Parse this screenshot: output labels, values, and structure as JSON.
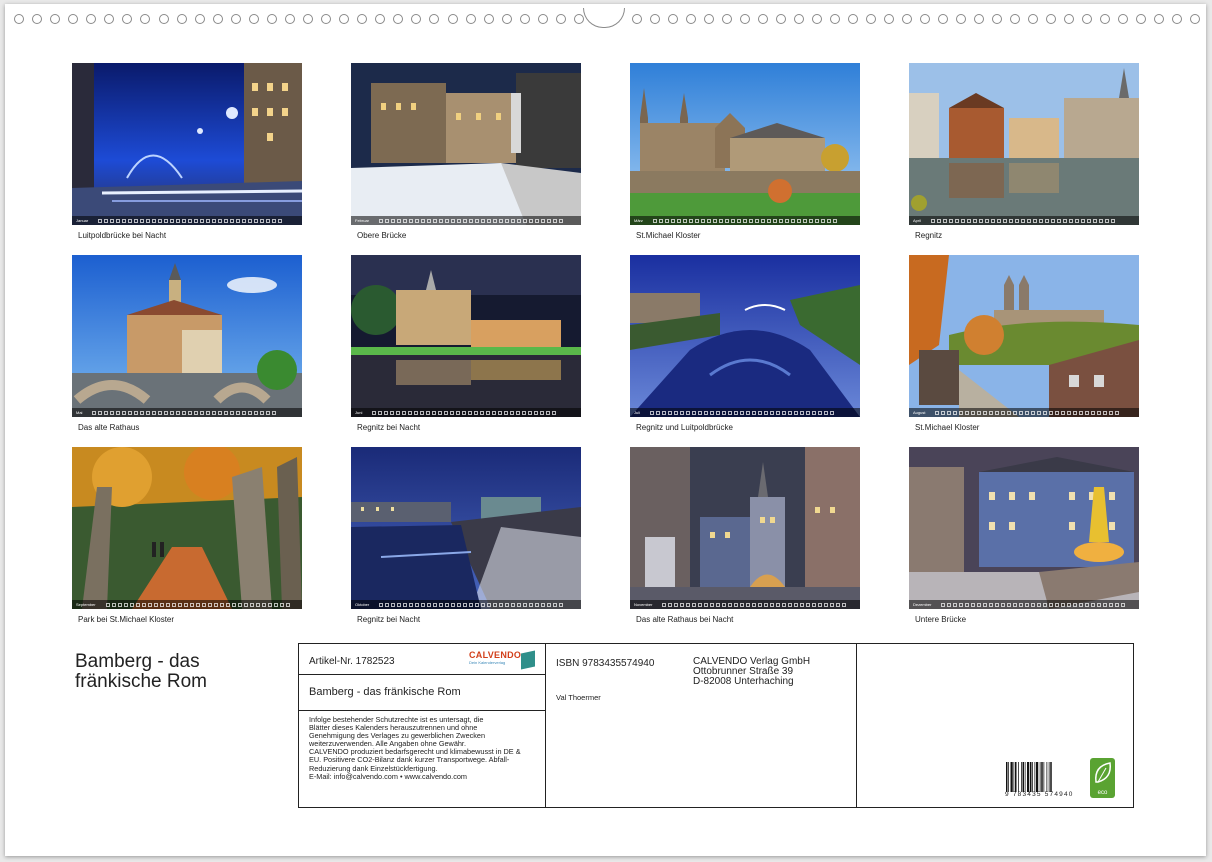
{
  "calendar": {
    "title_lines": [
      "Bamberg - das",
      "fränkische Rom"
    ]
  },
  "months": [
    {
      "month_label": "Januar",
      "caption": "Luitpoldbrücke bei Nacht"
    },
    {
      "month_label": "Februar",
      "caption": "Obere Brücke"
    },
    {
      "month_label": "März",
      "caption": "St.Michael Kloster"
    },
    {
      "month_label": "April",
      "caption": "Regnitz"
    },
    {
      "month_label": "Mai",
      "caption": "Das alte Rathaus"
    },
    {
      "month_label": "Juni",
      "caption": "Regnitz bei Nacht"
    },
    {
      "month_label": "Juli",
      "caption": "Regnitz und Luitpoldbrücke"
    },
    {
      "month_label": "August",
      "caption": "St.Michael Kloster"
    },
    {
      "month_label": "September",
      "caption": "Park bei St.Michael Kloster"
    },
    {
      "month_label": "Oktober",
      "caption": "Regnitz bei Nacht"
    },
    {
      "month_label": "November",
      "caption": "Das alte Rathaus bei Nacht"
    },
    {
      "month_label": "Dezember",
      "caption": "Untere Brücke"
    }
  ],
  "info": {
    "article": "Artikel-Nr. 1782523",
    "logo": {
      "name": "CALVENDO",
      "tagline": "Dein Kalenderverlag"
    },
    "box_title": "Bamberg - das fränkische Rom",
    "legal_text": [
      "Infolge bestehender Schutzrechte ist es untersagt, die",
      "Blätter dieses Kalenders herauszutrennen und ohne",
      "Genehmigung des Verlages zu gewerblichen Zwecken",
      "weiterzuverwenden. Alle Angaben ohne Gewähr.",
      "CALVENDO produziert bedarfsgerecht und klimabewusst in DE &",
      "EU. Positivere CO2-Bilanz dank kurzer Transportwege. Abfall-",
      "Reduzierung dank Einzelstückfertigung.",
      "E-Mail: info@calvendo.com • www.calvendo.com"
    ],
    "isbn": "ISBN 9783435574940",
    "author": "Val Thoermer",
    "publisher": [
      "CALVENDO Verlag GmbH",
      "Ottobrunner Straße 39",
      "D-82008 Unterhaching"
    ],
    "barcode_number": "9 783435 574940",
    "eco_label": "eco"
  },
  "icon_names": [
    "binding-ring-icon",
    "hanger-icon",
    "calvendo-logo",
    "barcode-icon",
    "eco-leaf-icon"
  ],
  "colors": {
    "calvendo_red": "#d23f1a",
    "calvendo_teal": "#2f8f8a",
    "eco_green": "#5aa332"
  }
}
